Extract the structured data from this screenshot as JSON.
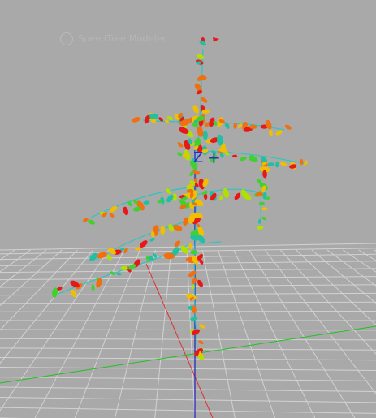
{
  "viewport": {
    "background": "#a9a9a9",
    "grid_color": "#d2d2d2",
    "axis_x_color": "#e03030",
    "axis_y_color": "#20c020",
    "axis_z_color": "#2020c0"
  },
  "watermark": {
    "text": "SpeedTree Modeler",
    "icon": "logo-icon"
  },
  "gizmo": {
    "z_label": "Z",
    "plus": "+"
  },
  "plant": {
    "leaf_colors": [
      "#e81818",
      "#f07010",
      "#f0c000",
      "#b0e000",
      "#40d030",
      "#20c0a0"
    ]
  }
}
